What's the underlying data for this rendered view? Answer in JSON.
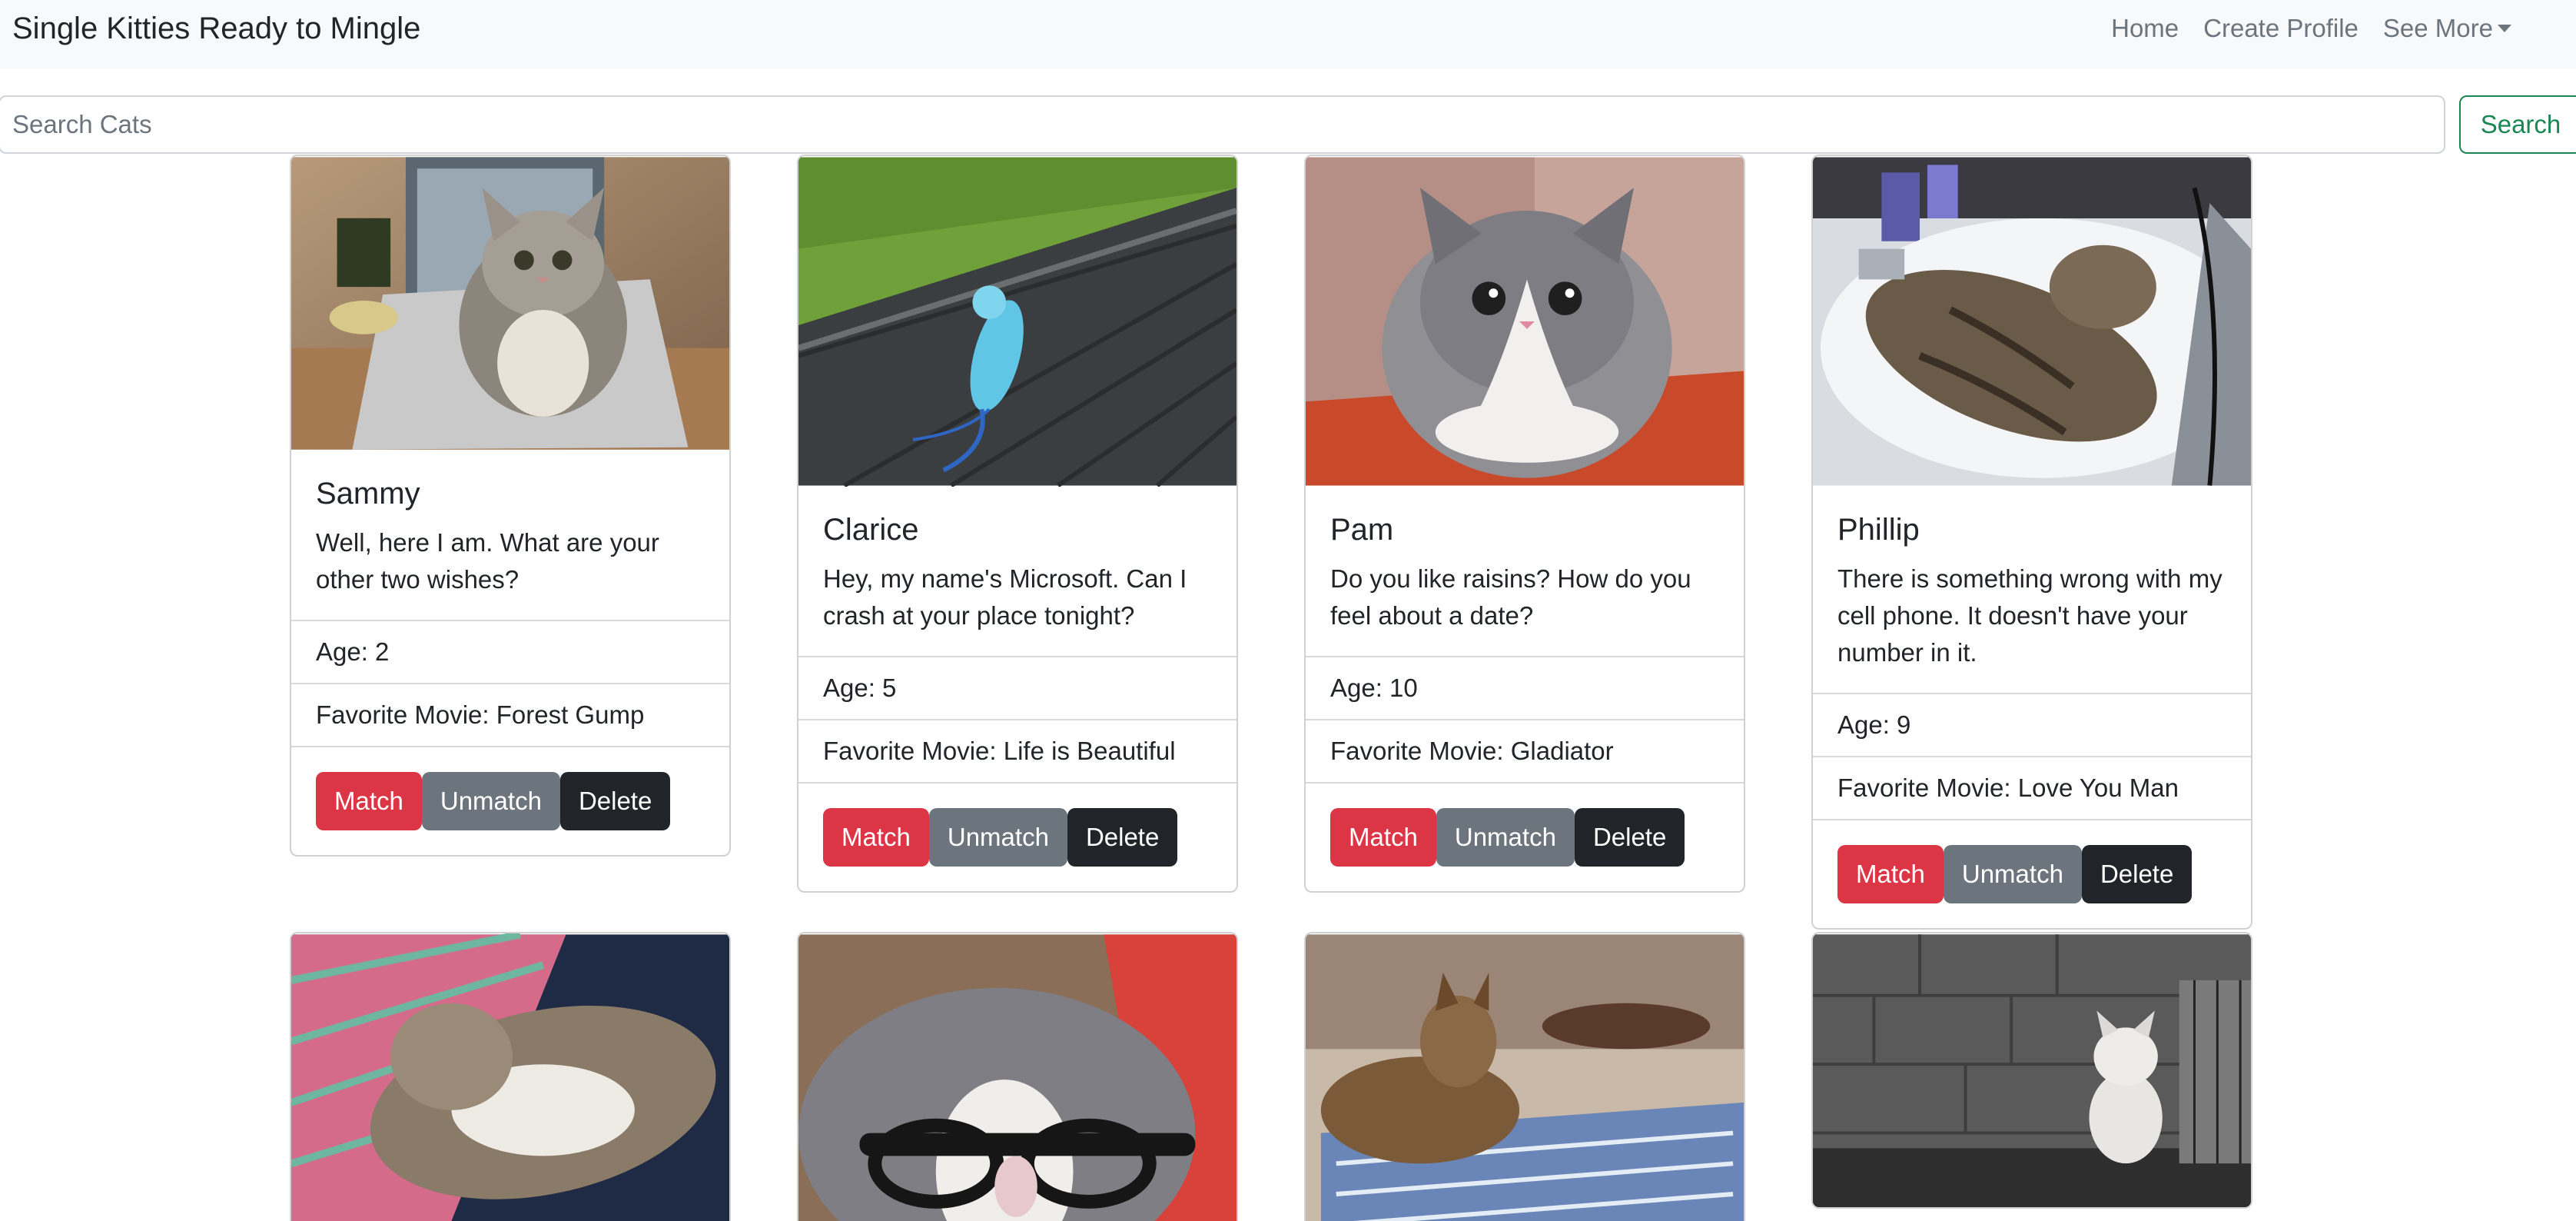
{
  "navbar": {
    "brand": "Single Kitties Ready to Mingle",
    "links": [
      "Home",
      "Create Profile",
      "See More"
    ]
  },
  "search": {
    "placeholder": "Search Cats",
    "button_label": "Search"
  },
  "buttons": {
    "match": "Match",
    "unmatch": "Unmatch",
    "delete": "Delete"
  },
  "cats": [
    {
      "name": "Sammy",
      "bio": "Well, here I am. What are your other two wishes?",
      "age": "Age: 2",
      "movie": "Favorite Movie: Forest Gump"
    },
    {
      "name": "Clarice",
      "bio": "Hey, my name's Microsoft. Can I crash at your place tonight?",
      "age": "Age: 5",
      "movie": "Favorite Movie: Life is Beautiful"
    },
    {
      "name": "Pam",
      "bio": "Do you like raisins? How do you feel about a date?",
      "age": "Age: 10",
      "movie": "Favorite Movie: Gladiator"
    },
    {
      "name": "Phillip",
      "bio": "There is something wrong with my cell phone. It doesn't have your number in it.",
      "age": "Age: 9",
      "movie": "Favorite Movie: Love You Man"
    }
  ]
}
